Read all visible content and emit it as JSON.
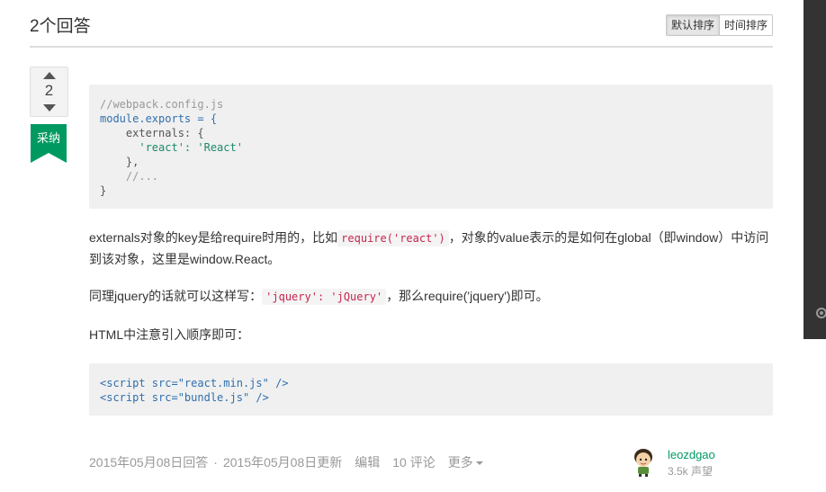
{
  "header": {
    "answers_title": "2个回答",
    "sort_default": "默认排序",
    "sort_time": "时间排序"
  },
  "vote": {
    "count": "2",
    "accepted_label": "采纳"
  },
  "answer": {
    "code1_lines": [
      "//webpack.config.js",
      "module.exports = {",
      "    externals: {",
      "      'react': 'React'",
      "    },",
      "    //...",
      "}"
    ],
    "p1_before": "externals对象的key是给require时用的，比如",
    "p1_code": "require('react')",
    "p1_after": "，对象的value表示的是如何在global（即window）中访问",
    "p1_line2": "到该对象，这里是window.React。",
    "p2_before": "同理jquery的话就可以这样写：",
    "p2_code": "'jquery': 'jQuery'",
    "p2_after": "，那么require('jquery')即可。",
    "p3": "HTML中注意引入顺序即可：",
    "code2_lines": [
      "<script src=\"react.min.js\" />",
      "<script src=\"bundle.js\" />"
    ]
  },
  "footer": {
    "answered": "2015年05月08日回答",
    "separator": "·",
    "updated": "2015年05月08日更新",
    "edit": "编辑",
    "comments": "10 评论",
    "more": "更多",
    "username": "leozdgao",
    "reputation": "3.5k",
    "reputation_label": "声望"
  },
  "colors": {
    "accent": "#009a61",
    "side_panel": "#333333"
  }
}
